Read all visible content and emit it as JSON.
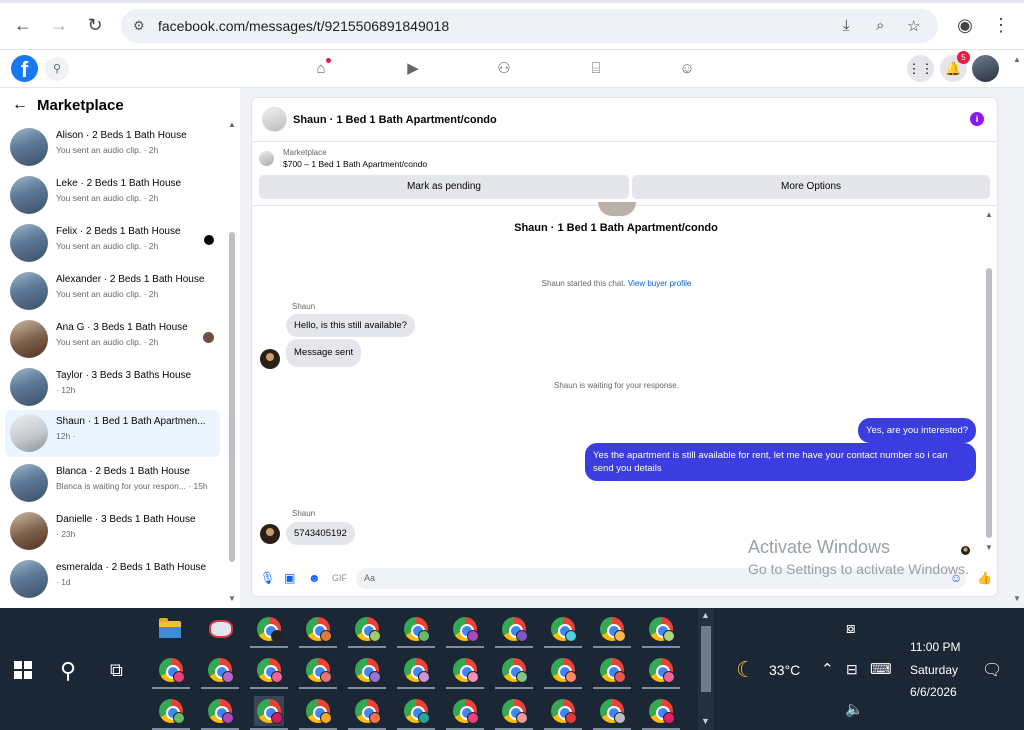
{
  "browser": {
    "url": "facebook.com/messages/t/9215506891849018"
  },
  "fb": {
    "logo_letter": "f",
    "notification_count": "5"
  },
  "sidebar": {
    "title": "Marketplace",
    "conversations": [
      {
        "name": "Alison · 2 Beds 1 Bath House",
        "sub": "You sent an audio clip. · 2h"
      },
      {
        "name": "Leke · 2 Beds 1 Bath House",
        "sub": "You sent an audio clip. · 2h"
      },
      {
        "name": "Felix · 2 Beds 1 Bath House",
        "sub": "You sent an audio clip. · 2h"
      },
      {
        "name": "Alexander · 2 Beds 1 Bath House",
        "sub": "You sent an audio clip. · 2h"
      },
      {
        "name": "Ana G · 3 Beds 1 Bath House",
        "sub": "You sent an audio clip. · 2h"
      },
      {
        "name": "Taylor · 3 Beds 3 Baths House",
        "sub": "· 12h"
      },
      {
        "name": "Shaun · 1 Bed 1 Bath Apartmen...",
        "sub": "12h ·"
      },
      {
        "name": "Blanca · 2 Beds 1 Bath House",
        "sub": "Blanca is waiting for your respon... · 15h"
      },
      {
        "name": "Danielle · 3 Beds 1 Bath House",
        "sub": "· 23h"
      },
      {
        "name": "esmeralda · 2 Beds 1 Bath House",
        "sub": "· 1d"
      }
    ]
  },
  "chat": {
    "header_title": "Shaun · 1 Bed 1 Bath Apartment/condo",
    "info_icon": "i",
    "marketplace_label": "Marketplace",
    "listing": "$700 – 1 Bed 1 Bath Apartment/condo",
    "mark_pending": "Mark as pending",
    "more_options": "More Options",
    "conversation_title": "Shaun · 1 Bed 1 Bath Apartment/condo",
    "started_text": "Shaun started this chat.",
    "view_profile": "View buyer profile",
    "sender1": "Shaun",
    "msg1": "Hello, is this still available?",
    "msg2": "Message sent",
    "waiting": "Shaun is waiting for your response.",
    "out1": "Yes, are you interested?",
    "out2": "Yes the apartment is still available for rent, let me have your contact number so i can send you details",
    "sender2": "Shaun",
    "msg3": "5743405192",
    "composer_placeholder": "Aa"
  },
  "watermark": {
    "line1": "Activate Windows",
    "line2": "Go to Settings to activate Windows."
  },
  "taskbar": {
    "weather": "33°C",
    "time": "11:00 PM",
    "day": "Saturday",
    "date": "6/6/2026"
  }
}
